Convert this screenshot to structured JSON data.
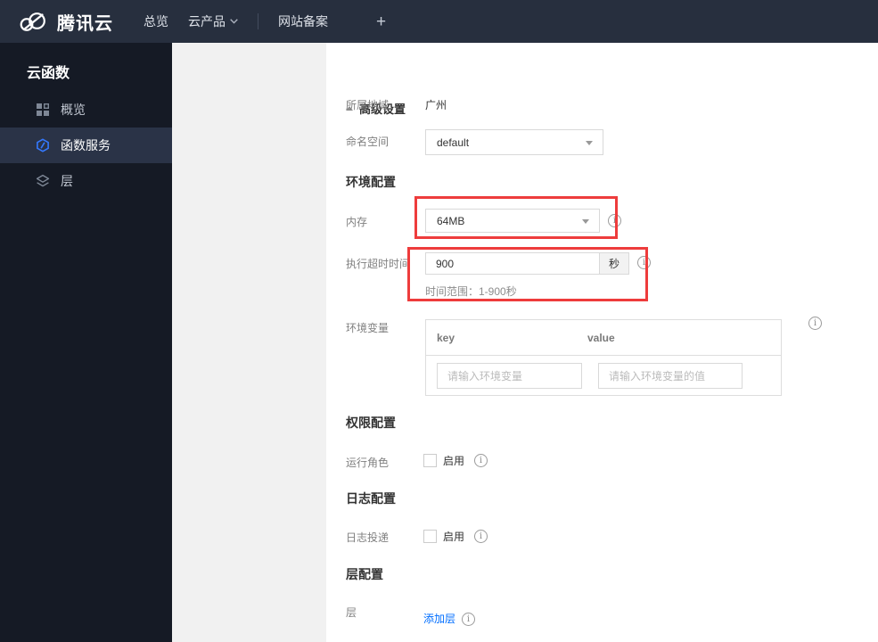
{
  "topbar": {
    "brand": "腾讯云",
    "nav": [
      {
        "label": "总览"
      },
      {
        "label": "云产品"
      },
      {
        "label": "网站备案"
      }
    ],
    "plus_label": "+"
  },
  "sidebar": {
    "title": "云函数",
    "items": [
      {
        "label": "概览",
        "icon": "grid-icon",
        "selected": false
      },
      {
        "label": "函数服务",
        "icon": "scf-hexagon-icon",
        "selected": true
      },
      {
        "label": "层",
        "icon": "layers-icon",
        "selected": false
      }
    ]
  },
  "form": {
    "advanced_toggle": "高级设置",
    "region_label": "所属地域",
    "region_value": "广州",
    "namespace_label": "命名空间",
    "namespace_value": "default",
    "env_section": "环境配置",
    "memory_label": "内存",
    "memory_value": "64MB",
    "timeout_label": "执行超时时间",
    "timeout_value": "900",
    "timeout_unit": "秒",
    "timeout_hint": "时间范围：1-900秒",
    "envvar_label": "环境变量",
    "envvar_key_header": "key",
    "envvar_value_header": "value",
    "envvar_key_placeholder": "请输入环境变量",
    "envvar_value_placeholder": "请输入环境变量的值",
    "perm_section": "权限配置",
    "runrole_label": "运行角色",
    "runrole_enable": "启用",
    "log_section": "日志配置",
    "logship_label": "日志投递",
    "logship_enable": "启用",
    "layer_section": "层配置",
    "layer_label": "层",
    "layer_add_link": "添加层"
  },
  "colors": {
    "topbar_bg": "#272f3e",
    "sidebar_bg": "#151a25",
    "sidebar_selected_bg": "#2a3347",
    "accent_blue": "#006eff",
    "highlight_red": "#ee3c3c"
  }
}
